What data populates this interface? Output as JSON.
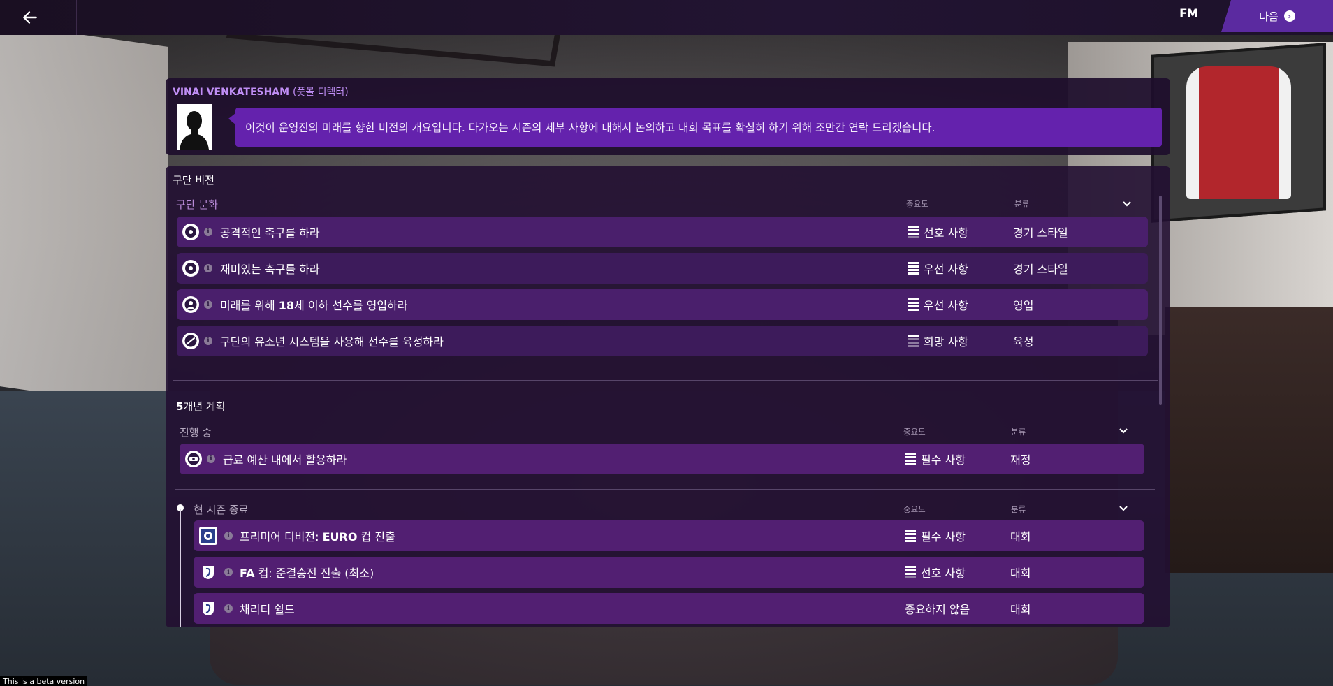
{
  "topbar": {
    "logo": "FM",
    "next_label": "다음"
  },
  "message": {
    "name": "VINAI VENKATESHAM",
    "role": "(풋볼 디렉터)",
    "text": "이것이 운영진의 미래를 향한 비전의 개요입니다. 다가오는 시즌의 세부 사항에 대해서 논의하고 대회 목표를 확실히 하기 위해 조만간 연락 드리겠습니다."
  },
  "vision": {
    "title": "구단 비전",
    "culture": {
      "heading": "구단 문화",
      "col_importance": "중요도",
      "col_category": "분류",
      "rows": [
        {
          "label": "공격적인 축구를 하라",
          "importance": "선호 사항",
          "category": "경기 스타일",
          "icon": "ball-icon"
        },
        {
          "label": "재미있는 축구를 하라",
          "importance": "우선 사항",
          "category": "경기 스타일",
          "icon": "ball-icon"
        },
        {
          "label_pre": "미래를 위해 ",
          "label_bold": "18",
          "label_post": "세 이하 선수를 영입하라",
          "importance": "우선 사항",
          "category": "영입",
          "icon": "person-icon"
        },
        {
          "label": "구단의 유소년 시스템을 사용해 선수를 육성하라",
          "importance": "희망 사항",
          "category": "육성",
          "icon": "whistle-icon"
        }
      ]
    },
    "plan": {
      "title_bold": "5",
      "title_rest": "개년 계획",
      "in_progress": {
        "heading": "진행 중",
        "col_importance": "중요도",
        "col_category": "분류",
        "rows": [
          {
            "label": "급료 예산 내에서 활용하라",
            "importance": "필수 사항",
            "category": "재정",
            "icon": "money-icon"
          }
        ]
      },
      "season_end": {
        "heading": "현 시즌 종료",
        "col_importance": "중요도",
        "col_category": "분류",
        "rows": [
          {
            "label_pre": "프리미어 디비전: ",
            "label_bold": "EURO",
            "label_post": " 컵 진출",
            "importance": "필수 사항",
            "category": "대회",
            "icon": "league-badge-icon"
          },
          {
            "label_bold": "FA",
            "label_post": " 컵: 준결승전 진출 (최소)",
            "importance": "선호 사항",
            "category": "대회",
            "icon": "cup-badge-icon"
          },
          {
            "label": "채리티 쉴드",
            "importance": "중요하지 않음",
            "category": "대회",
            "icon": "shield-badge-icon"
          }
        ]
      }
    }
  },
  "footer": {
    "beta_text": "This is a beta version"
  }
}
